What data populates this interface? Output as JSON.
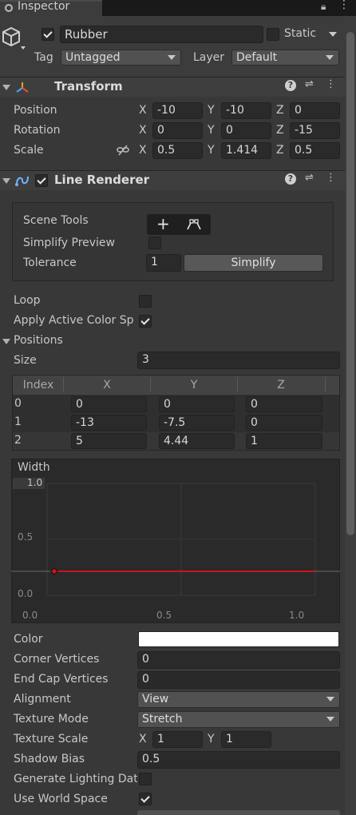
{
  "tab": {
    "title": "Inspector"
  },
  "object": {
    "name": "Rubber",
    "static_label": "Static",
    "tag_label": "Tag",
    "tag_value": "Untagged",
    "layer_label": "Layer",
    "layer_value": "Default",
    "active": true,
    "static": false
  },
  "transform": {
    "title": "Transform",
    "position_label": "Position",
    "rotation_label": "Rotation",
    "scale_label": "Scale",
    "x": "X",
    "y": "Y",
    "z": "Z",
    "position": {
      "x": "-10",
      "y": "-10",
      "z": "0"
    },
    "rotation": {
      "x": "0",
      "y": "0",
      "z": "-15"
    },
    "scale": {
      "x": "0.5",
      "y": "1.414",
      "z": "0.5"
    }
  },
  "line_renderer": {
    "title": "Line Renderer",
    "enabled": true,
    "scene_tools_label": "Scene Tools",
    "simplify_preview_label": "Simplify Preview",
    "tolerance_label": "Tolerance",
    "tolerance_value": "1",
    "simplify_button": "Simplify",
    "loop_label": "Loop",
    "loop": false,
    "apply_color_label": "Apply Active Color Sp",
    "apply_color": true,
    "positions_label": "Positions",
    "size_label": "Size",
    "size_value": "3",
    "grid_headers": [
      "Index",
      "X",
      "Y",
      "Z"
    ],
    "rows": [
      {
        "index": "0",
        "x": "0",
        "y": "0",
        "z": "0"
      },
      {
        "index": "1",
        "x": "-13",
        "y": "-7.5",
        "z": "0"
      },
      {
        "index": "2",
        "x": "5",
        "y": "4.44",
        "z": "1"
      }
    ],
    "width_label": "Width",
    "curve_y_max": "1.0",
    "curve_y_mid": "0.5",
    "curve_y_min": "0.0",
    "curve_x_min": "0.0",
    "curve_x_mid": "0.5",
    "curve_x_max": "1.0",
    "color_label": "Color",
    "color_value": "#ffffff",
    "corner_vertices_label": "Corner Vertices",
    "corner_vertices": "0",
    "end_cap_vertices_label": "End Cap Vertices",
    "end_cap_vertices": "0",
    "alignment_label": "Alignment",
    "alignment": "View",
    "texture_mode_label": "Texture Mode",
    "texture_mode": "Stretch",
    "texture_scale_label": "Texture Scale",
    "texture_scale_x": "1",
    "texture_scale_y": "1",
    "shadow_bias_label": "Shadow Bias",
    "shadow_bias": "0.5",
    "gen_lighting_label": "Generate Lighting Dat",
    "gen_lighting": false,
    "world_space_label": "Use World Space",
    "world_space": true
  }
}
